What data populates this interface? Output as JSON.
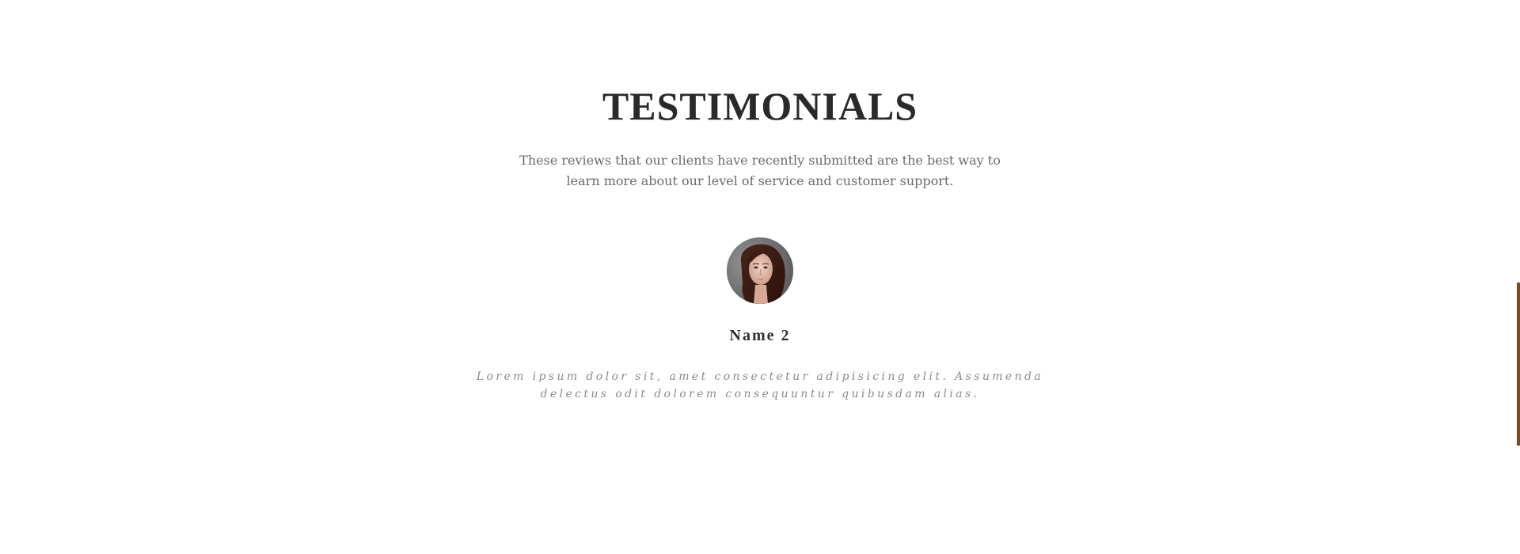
{
  "section": {
    "title": "TESTIMONIALS",
    "subtitle": "These reviews that our clients have recently submitted are the best way to learn more about our level of service and customer support."
  },
  "testimonial": {
    "avatar_icon": "portrait-woman-icon",
    "name": "Name 2",
    "quote": "Lorem ipsum dolor sit, amet consectetur adipisicing elit. Assumenda delectus odit dolorem consequuntur quibusdam alias."
  },
  "colors": {
    "background": "#ffffff",
    "title": "#2a2a2a",
    "subtitle": "#6a6a6a",
    "quote": "#8a8a8a",
    "accent": "#7a4a25"
  }
}
